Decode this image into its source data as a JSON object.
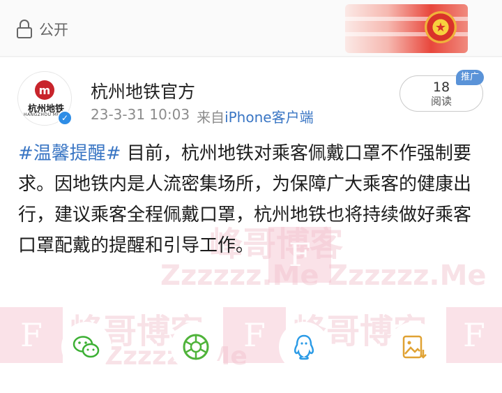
{
  "visibility": {
    "icon": "lock-icon",
    "label": "公开"
  },
  "account": {
    "logo_text": "杭州地铁",
    "logo_sub": "HANGZHOU METRO",
    "name": "杭州地铁官方",
    "date": "23-3-31 10:03",
    "source_prefix": "来自",
    "source_client": "iPhone客户端",
    "verified_icon": "verified-badge-icon"
  },
  "stats": {
    "reads_count": "18",
    "reads_label": "阅读",
    "promote_label": "推广"
  },
  "post": {
    "hashtag": "#温馨提醒#",
    "text": " 目前，杭州地铁对乘客佩戴口罩不作强制要求。因地铁内是人流密集场所，为保障广大乘客的健康出行，建议乘客全程佩戴口罩，杭州地铁也将持续做好乘客口罩配戴的提醒和引导工作。"
  },
  "watermark": {
    "cn": "峰哥博客",
    "en": "Zzzzzz.Me",
    "letter": "F"
  },
  "share_targets": [
    {
      "icon": "wechat-icon",
      "color": "#3cb034"
    },
    {
      "icon": "moments-icon",
      "color": "#4fb33a"
    },
    {
      "icon": "qq-icon",
      "color": "#2b9be6"
    },
    {
      "icon": "save-image-icon",
      "color": "#e0a233"
    }
  ],
  "colors": {
    "link": "#3a76c4",
    "brand_red": "#c8242b",
    "promo": "#5a93d8"
  }
}
